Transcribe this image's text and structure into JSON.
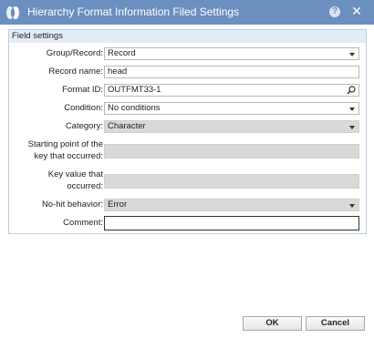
{
  "window": {
    "title": "Hierarchy Format Information Filed Settings",
    "help_icon_glyph": "?",
    "close_icon_glyph": "✕",
    "titlebar_color": "#6b8fbf"
  },
  "panel": {
    "header": "Field settings"
  },
  "fields": {
    "group_record": {
      "label": "Group/Record:",
      "value": "Record"
    },
    "record_name": {
      "label": "Record name:",
      "value": "head"
    },
    "format_id": {
      "label": "Format ID:",
      "value": "OUTFMT33-1"
    },
    "condition": {
      "label": "Condition:",
      "value": "No conditions"
    },
    "category": {
      "label": "Category:",
      "value": "Character"
    },
    "start_point": {
      "label_line1": "Starting point of the",
      "label_line2": "key that occurred:",
      "value": ""
    },
    "key_value": {
      "label_line1": "Key value that",
      "label_line2": "occurred:",
      "value": ""
    },
    "no_hit": {
      "label": "No-hit behavior:",
      "value": "Error"
    },
    "comment": {
      "label": "Comment:",
      "value": ""
    }
  },
  "buttons": {
    "ok": "OK",
    "cancel": "Cancel"
  }
}
